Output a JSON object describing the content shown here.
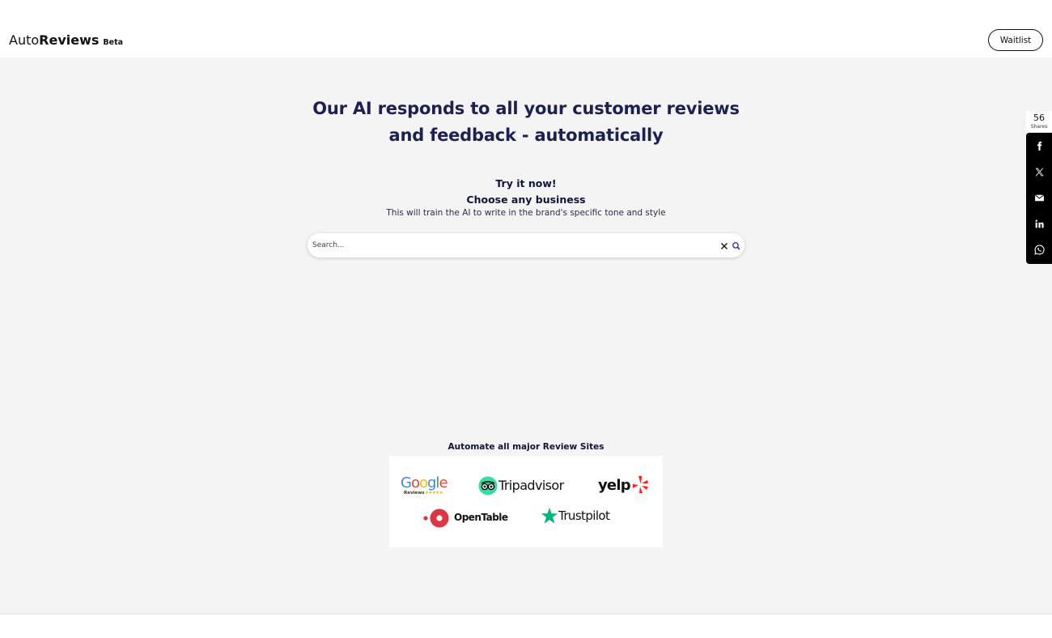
{
  "header": {
    "logo_auto": "Auto",
    "logo_reviews": "Reviews",
    "logo_beta": "Beta",
    "waitlist_label": "Waitlist"
  },
  "hero": {
    "headline_line1": "Our AI responds to all your customer reviews",
    "headline_line2": "and feedback - automatically",
    "try_line1": "Try it now!",
    "try_line2": "Choose any business",
    "subtext": "This will train the AI to write in the brand's specific tone and style",
    "search_placeholder": "Search..."
  },
  "review_sites": {
    "heading": "Automate all major Review Sites",
    "google_word": "Google",
    "google_sub": "Reviews",
    "google_stars": "★★★★★",
    "tripadvisor": "Tripadvisor",
    "yelp": "yelp",
    "opentable": "OpenTable",
    "trustpilot": "Trustpilot"
  },
  "share": {
    "count": "56",
    "label": "Shares"
  },
  "icons": [
    "close-icon",
    "search-icon",
    "facebook-icon",
    "x-icon",
    "email-icon",
    "linkedin-icon",
    "whatsapp-icon"
  ],
  "colors": {
    "headline": "#1c2152",
    "background": "#f4f4f4",
    "share_bar": "#000000",
    "google_blue": "#4285F4",
    "google_red": "#EA4335",
    "google_yellow": "#FBBC05",
    "google_green": "#34A853",
    "tripadvisor_green": "#34E0A1",
    "yelp_red": "#FF1A1A",
    "opentable_red": "#DA3743",
    "trustpilot_green": "#00B67A"
  }
}
